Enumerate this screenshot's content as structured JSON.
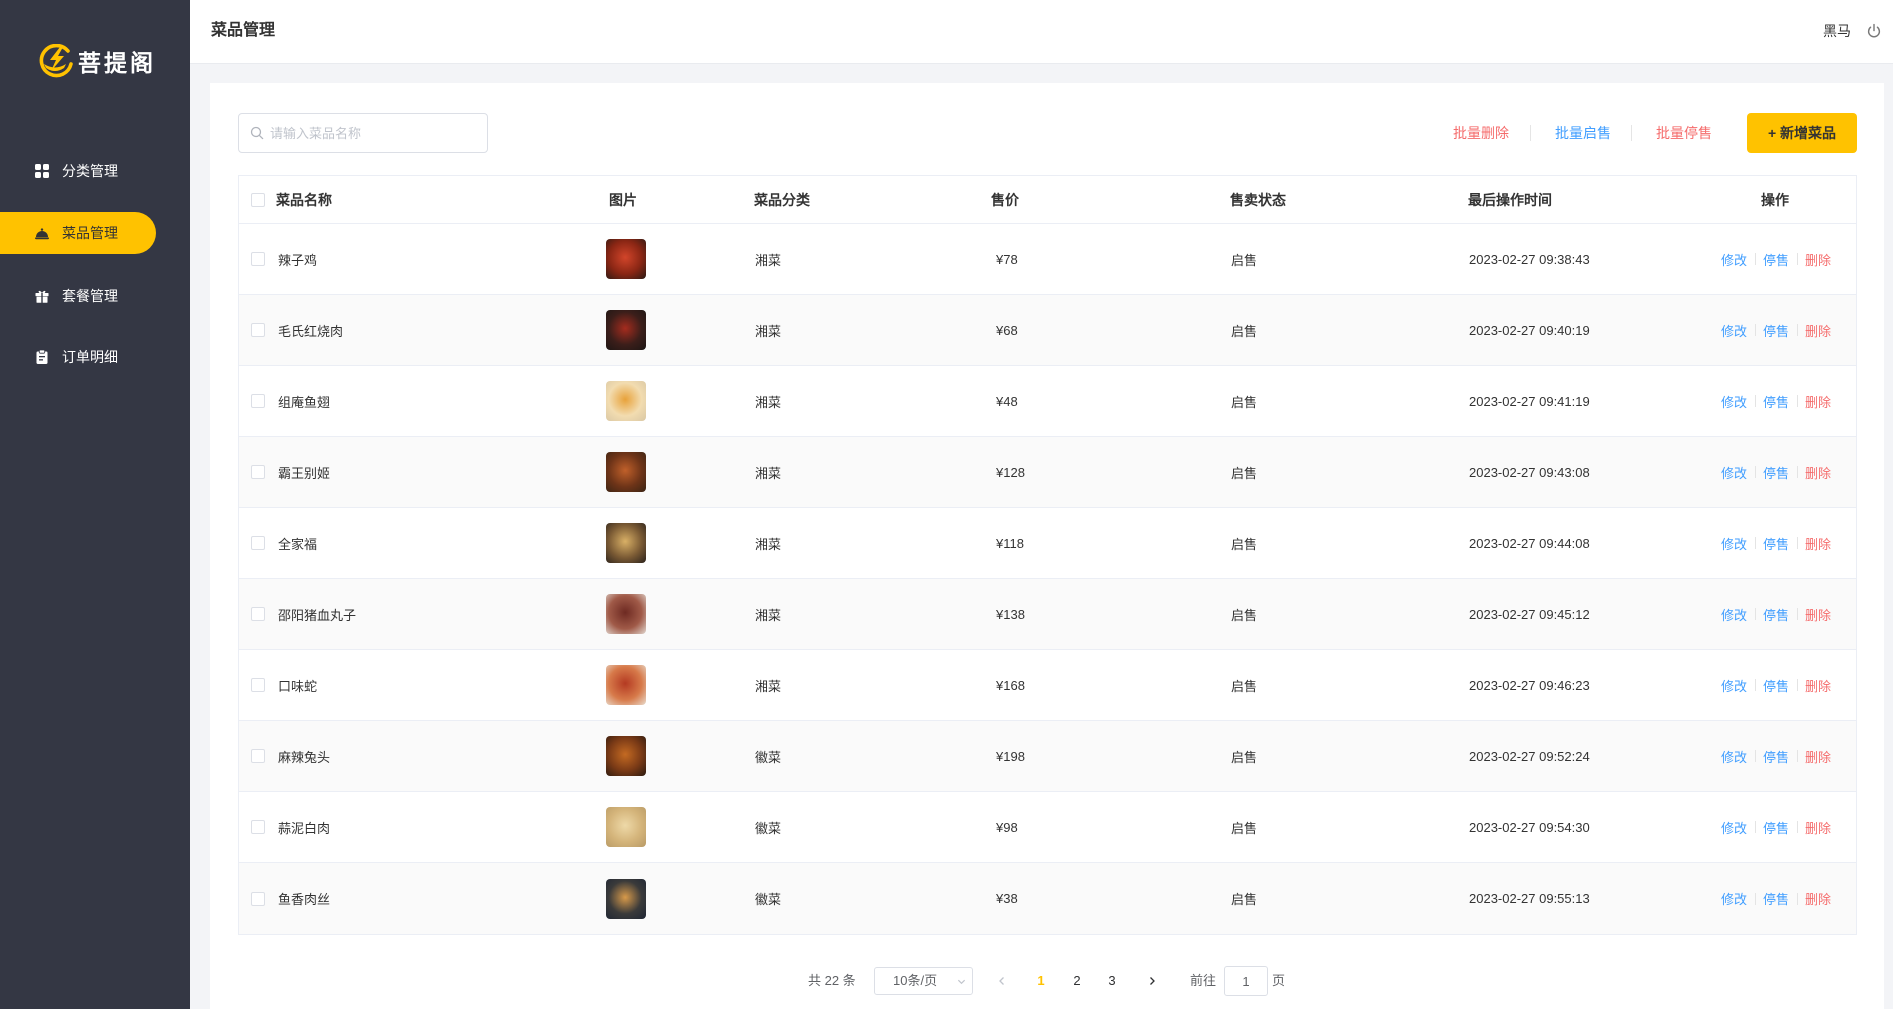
{
  "app": {
    "logo_text": "菩提阁",
    "logo_icon": "logo-icon",
    "brand_color": "#ffc200",
    "sidebar_color": "#343744",
    "link_blue": "#419eff",
    "danger_red": "#f56c6c"
  },
  "sidebar": {
    "items": [
      {
        "label": "分类管理",
        "icon": "grid-icon",
        "active": false
      },
      {
        "label": "菜品管理",
        "icon": "dish-cover-icon",
        "active": true
      },
      {
        "label": "套餐管理",
        "icon": "gift-icon",
        "active": false
      },
      {
        "label": "订单明细",
        "icon": "clipboard-icon",
        "active": false
      }
    ]
  },
  "header": {
    "title": "菜品管理",
    "user_name": "黑马",
    "logout_icon": "power-icon"
  },
  "toolbar": {
    "search_placeholder": "请输入菜品名称",
    "search_icon": "search-icon",
    "batch_delete": "批量删除",
    "batch_enable": "批量启售",
    "batch_disable": "批量停售",
    "add_dish": "+ 新增菜品"
  },
  "table": {
    "columns": [
      "菜品名称",
      "图片",
      "菜品分类",
      "售价",
      "售卖状态",
      "最后操作时间",
      "操作"
    ],
    "actions": {
      "edit": "修改",
      "stop": "停售",
      "delete": "删除"
    },
    "rows": [
      {
        "name": "辣子鸡",
        "category": "湘菜",
        "price": "¥78",
        "status": "启售",
        "updated": "2023-02-27 09:38:43",
        "thumb_colors": [
          "#d2452a",
          "#8a2614",
          "#2a1a14"
        ]
      },
      {
        "name": "毛氏红烧肉",
        "category": "湘菜",
        "price": "¥68",
        "status": "启售",
        "updated": "2023-02-27 09:40:19",
        "thumb_colors": [
          "#a52c1e",
          "#3b1e1a",
          "#1c1614"
        ]
      },
      {
        "name": "组庵鱼翅",
        "category": "湘菜",
        "price": "¥48",
        "status": "启售",
        "updated": "2023-02-27 09:41:19",
        "thumb_colors": [
          "#e8a23a",
          "#f2dcb0",
          "#d9c7a4"
        ]
      },
      {
        "name": "霸王别姬",
        "category": "湘菜",
        "price": "¥128",
        "status": "启售",
        "updated": "2023-02-27 09:43:08",
        "thumb_colors": [
          "#c0602a",
          "#6e3418",
          "#3a2414"
        ]
      },
      {
        "name": "全家福",
        "category": "湘菜",
        "price": "¥118",
        "status": "启售",
        "updated": "2023-02-27 09:44:08",
        "thumb_colors": [
          "#d9b066",
          "#7a5a34",
          "#2b221c"
        ]
      },
      {
        "name": "邵阳猪血丸子",
        "category": "湘菜",
        "price": "¥138",
        "status": "启售",
        "updated": "2023-02-27 09:45:12",
        "thumb_colors": [
          "#6e2a22",
          "#a05a48",
          "#e2d8d0"
        ]
      },
      {
        "name": "口味蛇",
        "category": "湘菜",
        "price": "¥168",
        "status": "启售",
        "updated": "2023-02-27 09:46:23",
        "thumb_colors": [
          "#b43a22",
          "#d77a4a",
          "#e9dccd"
        ]
      },
      {
        "name": "麻辣兔头",
        "category": "徽菜",
        "price": "¥198",
        "status": "启售",
        "updated": "2023-02-27 09:52:24",
        "thumb_colors": [
          "#c46a22",
          "#7a3a16",
          "#2a1a10"
        ]
      },
      {
        "name": "蒜泥白肉",
        "category": "徽菜",
        "price": "¥98",
        "status": "启售",
        "updated": "2023-02-27 09:54:30",
        "thumb_colors": [
          "#eed9a8",
          "#d4b47a",
          "#b89a66"
        ]
      },
      {
        "name": "鱼香肉丝",
        "category": "徽菜",
        "price": "¥38",
        "status": "启售",
        "updated": "2023-02-27 09:55:13",
        "thumb_colors": [
          "#d89a4a",
          "#3a3a3a",
          "#1e2634"
        ]
      }
    ]
  },
  "pagination": {
    "total_text": "共 22 条",
    "page_size": "10条/页",
    "pages": [
      "1",
      "2",
      "3"
    ],
    "current": 1,
    "prev_icon": "chevron-left-icon",
    "next_icon": "chevron-right-icon",
    "goto_label": "前往",
    "goto_value": "1",
    "page_unit": "页"
  }
}
